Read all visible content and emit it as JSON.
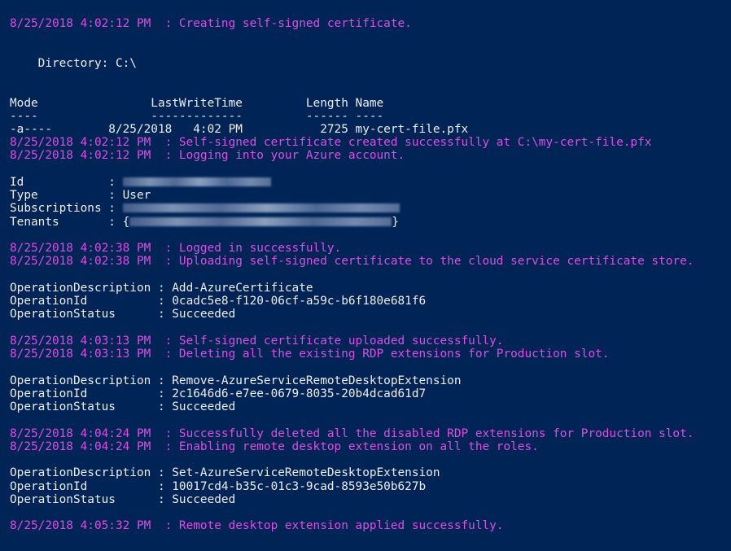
{
  "console": {
    "lines": [
      {
        "kind": "log",
        "text": "8/25/2018 4:02:12 PM  : Creating self-signed certificate."
      },
      {
        "kind": "out",
        "text": "    Directory: C:\\"
      },
      {
        "kind": "out",
        "text": "Mode                LastWriteTime         Length Name"
      },
      {
        "kind": "out",
        "text": "----                -------------         ------ ----"
      },
      {
        "kind": "out",
        "text": "-a----        8/25/2018   4:02 PM           2725 my-cert-file.pfx"
      },
      {
        "kind": "log",
        "text": "8/25/2018 4:02:12 PM  : Self-signed certificate created successfully at C:\\my-cert-file.pfx"
      },
      {
        "kind": "log",
        "text": "8/25/2018 4:02:12 PM  : Logging into your Azure account."
      },
      {
        "kind": "out",
        "text": "Id            : "
      },
      {
        "kind": "out",
        "text": "Type          : User"
      },
      {
        "kind": "out",
        "text": "Subscriptions : "
      },
      {
        "kind": "out",
        "text": "Tenants       : {"
      },
      {
        "kind": "log",
        "text": "8/25/2018 4:02:38 PM  : Logged in successfully."
      },
      {
        "kind": "log",
        "text": "8/25/2018 4:02:38 PM  : Uploading self-signed certificate to the cloud service certificate store."
      },
      {
        "kind": "out",
        "text": "OperationDescription : Add-AzureCertificate"
      },
      {
        "kind": "out",
        "text": "OperationId          : 0cadc5e8-f120-06cf-a59c-b6f180e681f6"
      },
      {
        "kind": "out",
        "text": "OperationStatus      : Succeeded"
      },
      {
        "kind": "log",
        "text": "8/25/2018 4:03:13 PM  : Self-signed certificate uploaded successfully."
      },
      {
        "kind": "log",
        "text": "8/25/2018 4:03:13 PM  : Deleting all the existing RDP extensions for Production slot."
      },
      {
        "kind": "out",
        "text": "OperationDescription : Remove-AzureServiceRemoteDesktopExtension"
      },
      {
        "kind": "out",
        "text": "OperationId          : 2c1646d6-e7ee-0679-8035-20b4dcad61d7"
      },
      {
        "kind": "out",
        "text": "OperationStatus      : Succeeded"
      },
      {
        "kind": "log",
        "text": "8/25/2018 4:04:24 PM  : Successfully deleted all the disabled RDP extensions for Production slot."
      },
      {
        "kind": "log",
        "text": "8/25/2018 4:04:24 PM  : Enabling remote desktop extension on all the roles."
      },
      {
        "kind": "out",
        "text": "OperationDescription : Set-AzureServiceRemoteDesktopExtension"
      },
      {
        "kind": "out",
        "text": "OperationId          : 10017cd4-b35c-01c3-9cad-8593e50b627b"
      },
      {
        "kind": "out",
        "text": "OperationStatus      : Succeeded"
      },
      {
        "kind": "log",
        "text": "8/25/2018 4:05:32 PM  : Remote desktop extension applied successfully."
      }
    ],
    "tenants_suffix": "}"
  },
  "colors": {
    "background": "#012456",
    "log_text": "#e24ce2",
    "output_text": "#eeedf0"
  }
}
